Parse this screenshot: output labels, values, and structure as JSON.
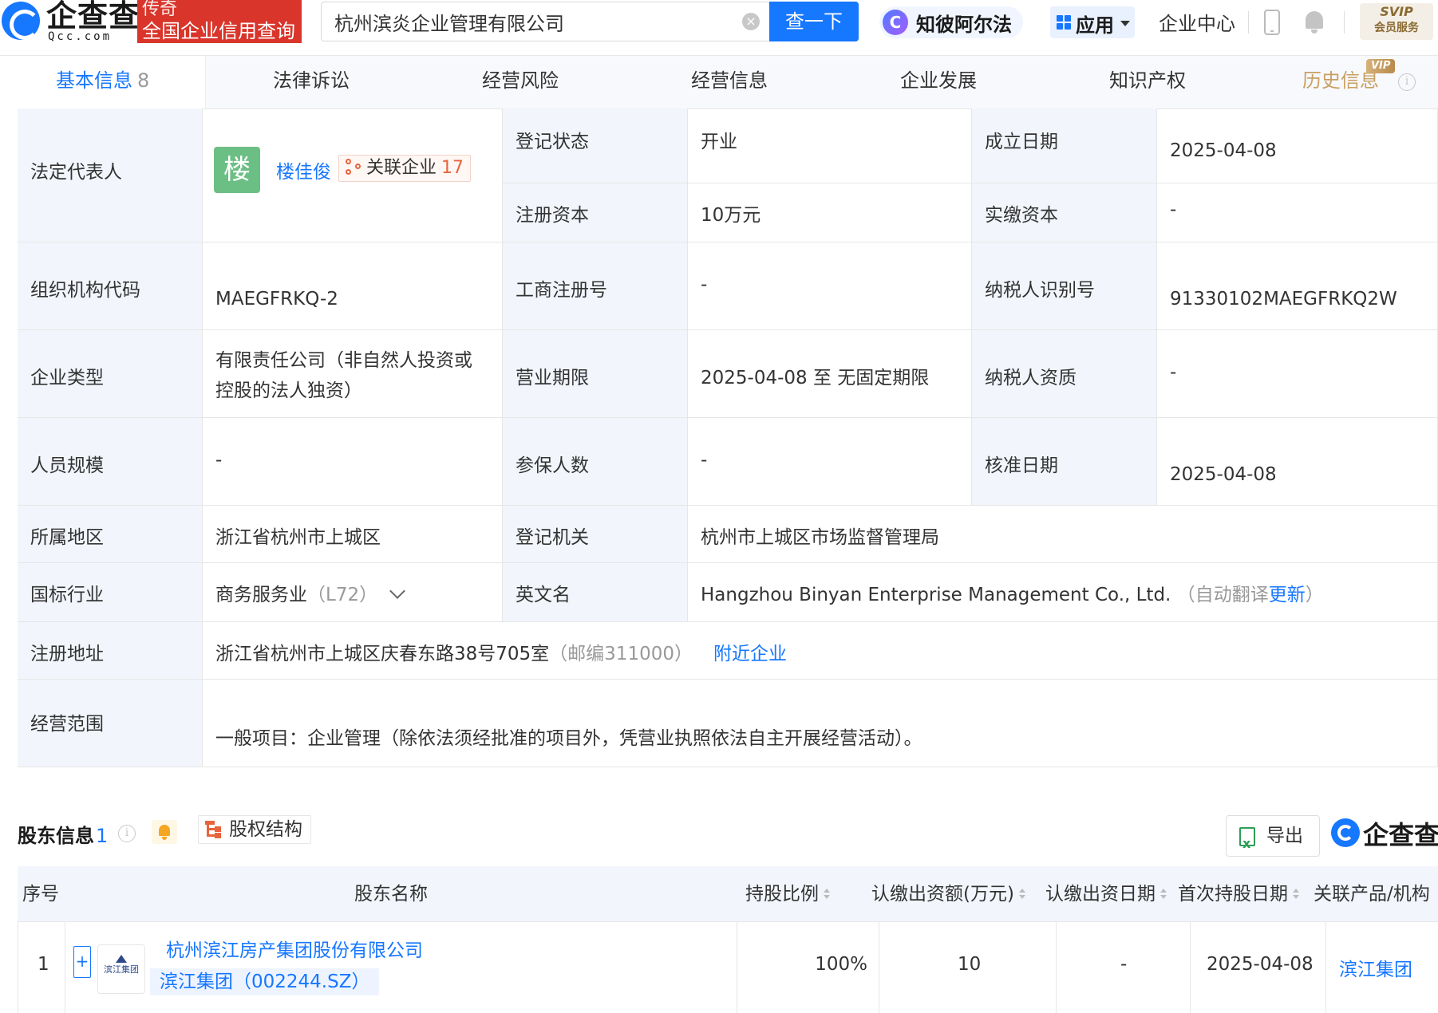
{
  "header": {
    "logo_cn": "企查查",
    "logo_en": "Qcc.com",
    "promo_line1": "传奇",
    "promo_line2": "全国企业信用查询",
    "search_value": "杭州滨炎企业管理有限公司",
    "search_button": "查一下",
    "zhibi_label": "知彼阿尔法",
    "apps_label": "应用",
    "enterprise_center": "企业中心",
    "svip_line1": "SVIP",
    "svip_line2": "会员服务"
  },
  "tabs": [
    {
      "label": "基本信息",
      "count": "8"
    },
    {
      "label": "法律诉讼"
    },
    {
      "label": "经营风险"
    },
    {
      "label": "经营信息"
    },
    {
      "label": "企业发展"
    },
    {
      "label": "知识产权"
    },
    {
      "label": "历史信息",
      "badge": "VIP"
    }
  ],
  "info": {
    "legal_rep_label": "法定代表人",
    "legal_rep_avatar": "楼",
    "legal_rep_name": "楼佳俊",
    "related_label": "关联企业",
    "related_count": "17",
    "reg_status_label": "登记状态",
    "reg_status": "开业",
    "found_date_label": "成立日期",
    "found_date": "2025-04-08",
    "reg_capital_label": "注册资本",
    "reg_capital": "10万元",
    "paid_capital_label": "实缴资本",
    "paid_capital": "-",
    "org_code_label": "组织机构代码",
    "org_code": "MAEGFRKQ-2",
    "biz_reg_no_label": "工商注册号",
    "biz_reg_no": "-",
    "tax_id_label": "纳税人识别号",
    "tax_id": "91330102MAEGFRKQ2W",
    "ent_type_label": "企业类型",
    "ent_type_l1": "有限责任公司（非自然人投资或",
    "ent_type_l2": "控股的法人独资）",
    "biz_term_label": "营业期限",
    "biz_term": "2025-04-08 至 无固定期限",
    "tax_qual_label": "纳税人资质",
    "tax_qual": "-",
    "staff_label": "人员规模",
    "staff": "-",
    "insured_label": "参保人数",
    "insured": "-",
    "approve_date_label": "核准日期",
    "approve_date": "2025-04-08",
    "region_label": "所属地区",
    "region": "浙江省杭州市上城区",
    "reg_auth_label": "登记机关",
    "reg_auth": "杭州市上城区市场监督管理局",
    "industry_label": "国标行业",
    "industry": "商务服务业",
    "industry_code": "（L72）",
    "en_name_label": "英文名",
    "en_name": "Hangzhou Binyan Enterprise Management Co., Ltd.",
    "auto_translate_prefix": "（自动翻译",
    "auto_translate_link": "更新",
    "auto_translate_suffix": "）",
    "address_label": "注册地址",
    "address": "浙江省杭州市上城区庆春东路38号705室",
    "postcode": "（邮编311000）",
    "nearby_link": "附近企业",
    "scope_label": "经营范围",
    "scope": "一般项目：企业管理（除依法须经批准的项目外，凭营业执照依法自主开展经营活动）。"
  },
  "shareholders": {
    "title": "股东信息",
    "count": "1",
    "equity_button": "股权结构",
    "export_button": "导出",
    "watermark": "企查查",
    "columns": [
      "序号",
      "股东名称",
      "持股比例",
      "认缴出资额(万元)",
      "认缴出资日期",
      "首次持股日期",
      "关联产品/机构"
    ],
    "rows": [
      {
        "index": "1",
        "logo_text": "滨江集团",
        "name": "杭州滨江房产集团股份有限公司",
        "stock_tag": "滨江集团（002244.SZ）",
        "ratio": "100%",
        "subscribed": "10",
        "sub_date": "-",
        "first_hold_date": "2025-04-08",
        "related_product": "滨江集团"
      }
    ]
  }
}
